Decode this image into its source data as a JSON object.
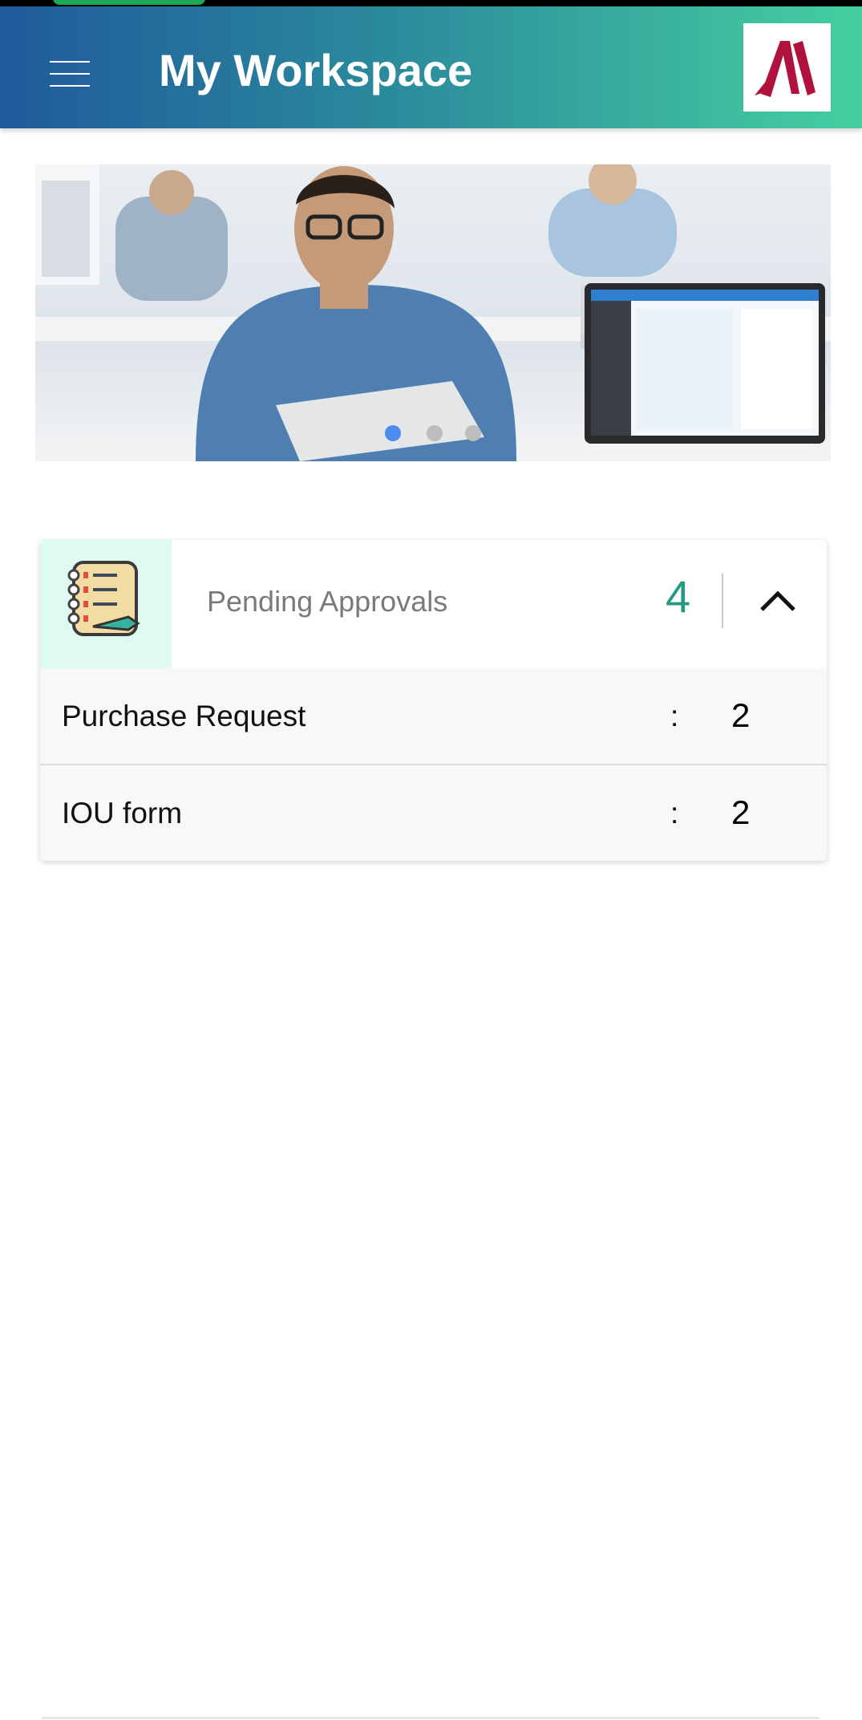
{
  "header": {
    "title": "My Workspace",
    "menu_icon": "hamburger-icon",
    "logo": "Marriott M logo",
    "logo_color": "#b0123d",
    "gradient": [
      "#1f5a9c",
      "#45cfa0"
    ]
  },
  "carousel": {
    "slides": 3,
    "active_index": 0,
    "active_color": "#4a8cf0",
    "inactive_color": "#bdbdbd"
  },
  "pending": {
    "title": "Pending Approvals",
    "count": "4",
    "count_color": "#259a80",
    "icon": "notebook-checklist-icon",
    "expanded": true,
    "items": [
      {
        "label": "Purchase Request",
        "sep": ":",
        "value": "2"
      },
      {
        "label": "IOU form",
        "sep": ":",
        "value": "2"
      }
    ]
  }
}
